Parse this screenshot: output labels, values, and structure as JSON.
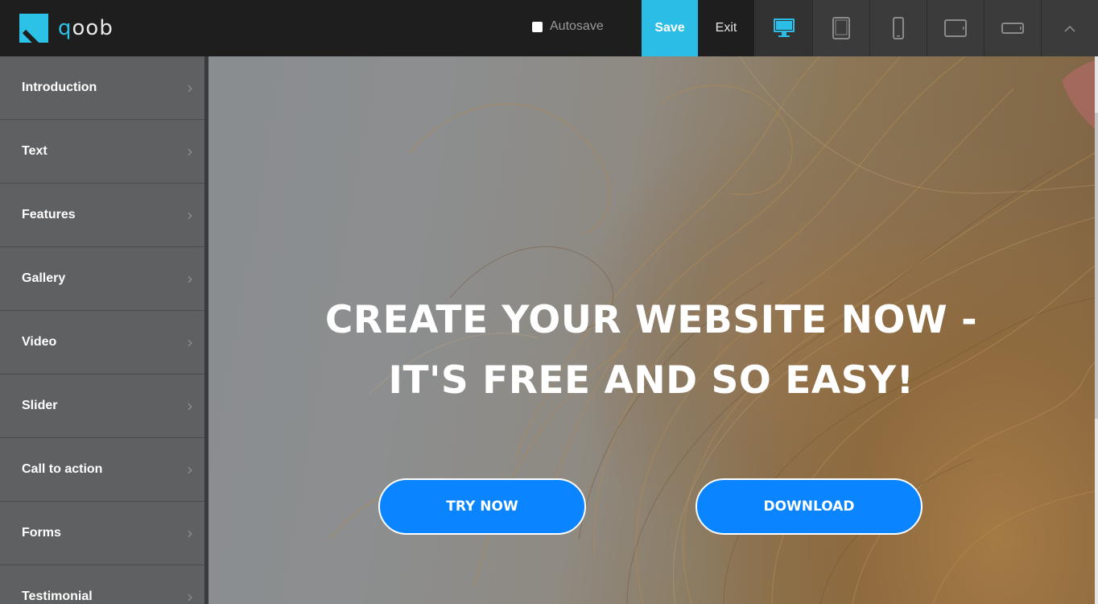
{
  "app": {
    "logo_text": "qoob",
    "logo_letter": "q",
    "logo_rest": "oob"
  },
  "toolbar": {
    "autosave_label": "Autosave",
    "save_label": "Save",
    "exit_label": "Exit",
    "devices": [
      "desktop-icon",
      "tablet-icon",
      "phone-icon",
      "tablet-landscape-icon",
      "phone-landscape-icon"
    ],
    "collapse_icon": "chevron-up-icon"
  },
  "sidebar": {
    "items": [
      {
        "label": "Introduction"
      },
      {
        "label": "Text"
      },
      {
        "label": "Features"
      },
      {
        "label": "Gallery"
      },
      {
        "label": "Video"
      },
      {
        "label": "Slider"
      },
      {
        "label": "Call to action"
      },
      {
        "label": "Forms"
      },
      {
        "label": "Testimonial"
      }
    ],
    "chevron": "›"
  },
  "hero": {
    "title": "CREATE YOUR WEBSITE NOW - IT'S FREE AND SO EASY!",
    "try_label": "TRY NOW",
    "download_label": "DOWNLOAD"
  },
  "colors": {
    "accent": "#2cbde6",
    "button_blue": "#0a84ff",
    "sidebar_bg": "#5f6062",
    "topbar_bg": "#1e1e1e"
  }
}
